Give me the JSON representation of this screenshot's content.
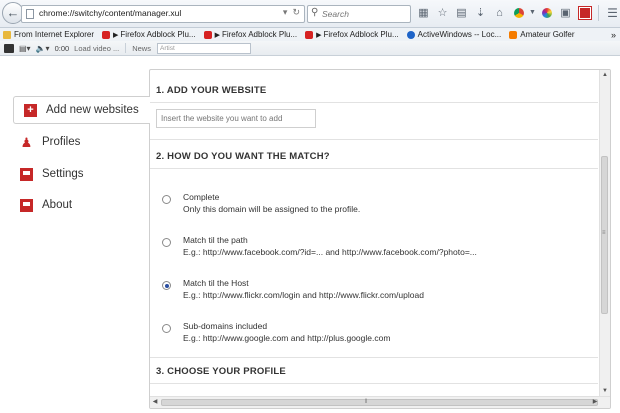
{
  "browser": {
    "url": "chrome://switchy/content/manager.xul",
    "search_placeholder": "Search"
  },
  "bookmarks": [
    {
      "label": "From Internet Explorer",
      "icon": "folder-icon"
    },
    {
      "label": "Firefox Adblock Plu...",
      "icon": "youtube-icon"
    },
    {
      "label": "Firefox Adblock Plu...",
      "icon": "youtube-icon"
    },
    {
      "label": "Firefox Adblock Plu...",
      "icon": "youtube-icon"
    },
    {
      "label": "ActiveWindows -- Loc...",
      "icon": "ie-icon"
    },
    {
      "label": "Amateur Golfer",
      "icon": "blogger-icon"
    }
  ],
  "addon_bar": {
    "time": "0:00",
    "load": "Load video ...",
    "news": "News",
    "artist_placeholder": "Artist"
  },
  "sidebar": [
    {
      "label": "Add new websites",
      "icon": "add-icon",
      "active": true
    },
    {
      "label": "Profiles",
      "icon": "profiles-icon",
      "active": false
    },
    {
      "label": "Settings",
      "icon": "settings-icon",
      "active": false
    },
    {
      "label": "About",
      "icon": "about-icon",
      "active": false
    }
  ],
  "main": {
    "section1_title": "1. ADD YOUR WEBSITE",
    "website_placeholder": "Insert the website you want to add",
    "section2_title": "2. HOW DO YOU WANT THE MATCH?",
    "options": [
      {
        "title": "Complete",
        "desc": "Only this domain will be assigned to the profile.",
        "checked": false
      },
      {
        "title": "Match til the path",
        "desc": "E.g.: http://www.facebook.com/?id=... and http://www.facebook.com/?photo=...",
        "checked": false
      },
      {
        "title": "Match til the Host",
        "desc": "E.g.: http://www.flickr.com/login and http://www.flickr.com/upload",
        "checked": true
      },
      {
        "title": "Sub-domains included",
        "desc": "E.g.: http://www.google.com and http://plus.google.com",
        "checked": false
      }
    ],
    "section3_title": "3. CHOOSE YOUR PROFILE"
  },
  "colors": {
    "accent": "#c62828",
    "radio_checked": "#2b4ea0"
  }
}
